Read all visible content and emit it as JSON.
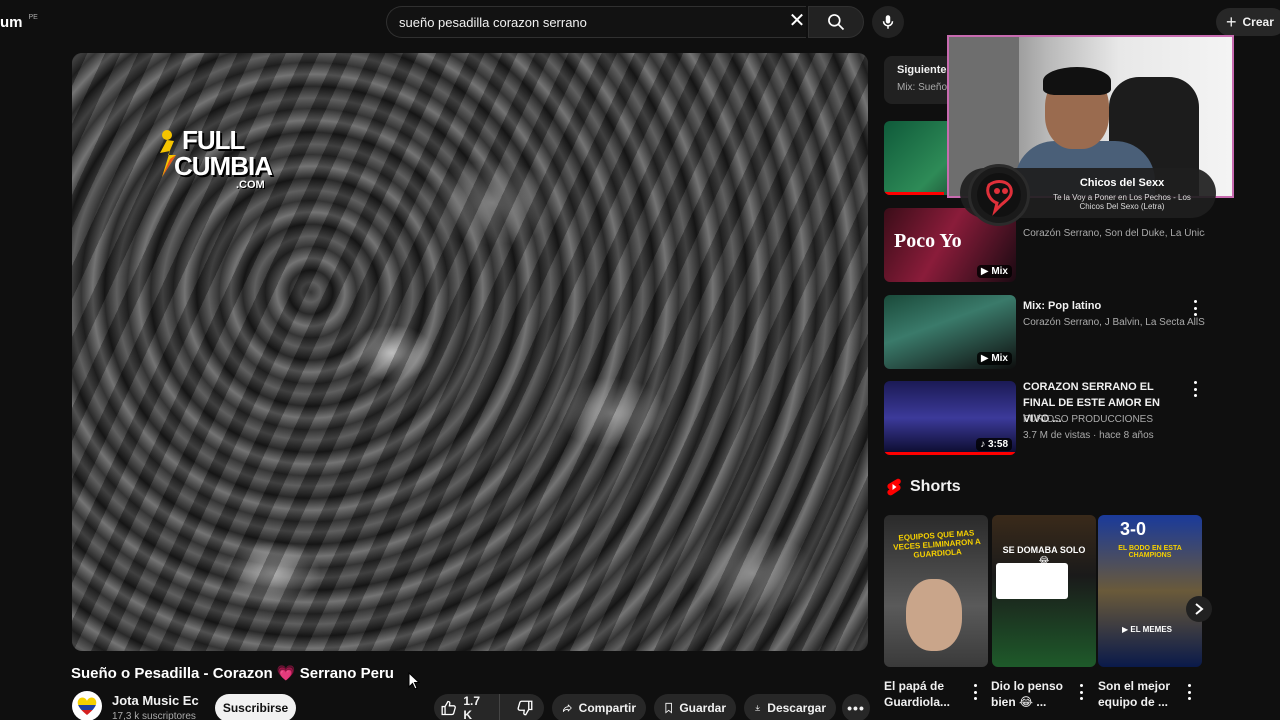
{
  "header": {
    "logo_fragment": "um",
    "country_code": "PE",
    "search_value": "sueño pesadilla corazon serrano",
    "create_label": "Crear"
  },
  "player": {
    "watermark_line1": "FULL",
    "watermark_line2": "CUMBIA",
    "watermark_line3": ".COM"
  },
  "video": {
    "title_part1": "Sueño o Pesadilla - Corazon",
    "title_heart": "💗",
    "title_part2": "Serrano Peru",
    "channel_name": "Jota Music Ec",
    "channel_subs": "17,3 k suscriptores",
    "subscribe_label": "Suscribirse",
    "likes": "1.7 K",
    "share_label": "Compartir",
    "save_label": "Guardar",
    "download_label": "Descargar"
  },
  "sidebar": {
    "next_label": "Siguiente:",
    "next_sub": "Mix: Sueño",
    "items": [
      {
        "title": "",
        "sub": "",
        "badge": ""
      },
      {
        "title": "",
        "sub": "Corazón Serrano, Son del Duke, La Única ...",
        "badge": "Mix",
        "thumb_text": "Poco Yo"
      },
      {
        "title": "Mix: Pop latino",
        "sub": "Corazón Serrano, J Balvin, La Secta AllSt...",
        "badge": "Mix"
      },
      {
        "title": "CORAZON SERRANO   EL FINAL DE ESTE AMOR   EN VIVO ...",
        "sub": "FURIOSO PRODUCCIONES",
        "meta": "3.7 M de vistas · hace 8 años",
        "badge": "3:58"
      }
    ]
  },
  "shorts": {
    "heading": "Shorts",
    "items": [
      {
        "title": "El papá de Guardiola...",
        "thumb_text": "EQUIPOS QUE MAS VECES ELIMINARON A GUARDIOLA"
      },
      {
        "title": "Dio lo penso bien 😂 ...",
        "thumb_text": "SE DOMABA SOLO 😂"
      },
      {
        "title": "Son el mejor equipo de ...",
        "thumb_text": "3-0",
        "thumb_text2": "EL BODO EN ESTA CHAMPIONS",
        "thumb_text3": "EL MEMES"
      }
    ]
  },
  "now_playing": {
    "title": "Chicos del Sexx",
    "subtitle": "Te la Voy a Poner en Los Pechos - Los Chicos Del Sexo (Letra)"
  },
  "colors": {
    "background": "#0f0f0f",
    "accent_red": "#ff0000",
    "webcam_border": "#c86bb0"
  }
}
